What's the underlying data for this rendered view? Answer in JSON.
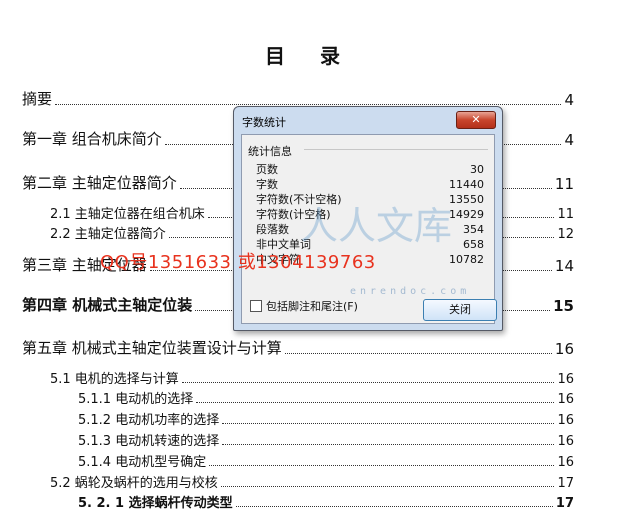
{
  "document": {
    "title": "目 录",
    "toc": [
      {
        "label": "摘要",
        "page": "4"
      },
      {
        "label": "第一章  组合机床简介",
        "page": "4"
      },
      {
        "label": "第二章  主轴定位器简介",
        "page": "11"
      },
      {
        "label": "2.1 主轴定位器在组合机床",
        "page": "11"
      },
      {
        "label": "2.2 主轴定位器简介",
        "page": "12"
      },
      {
        "label": "第三章  主轴定位器",
        "page": "14"
      },
      {
        "label": "第四章  机械式主轴定位装",
        "page": "15"
      },
      {
        "label": "第五章  机械式主轴定位装置设计与计算",
        "page": "16"
      },
      {
        "label": "5.1 电机的选择与计算",
        "page": "16"
      },
      {
        "label": "5.1.1 电动机的选择",
        "page": "16"
      },
      {
        "label": "5.1.2 电动机功率的选择",
        "page": "16"
      },
      {
        "label": "5.1.3 电动机转速的选择",
        "page": "16"
      },
      {
        "label": "5.1.4 电动机型号确定",
        "page": "16"
      },
      {
        "label": "5.2   蜗轮及蜗杆的选用与校核",
        "page": "17"
      },
      {
        "label": "5. 2. 1   选择蜗杆传动类型",
        "page": "17"
      }
    ]
  },
  "dialog": {
    "title": "字数统计",
    "close_glyph": "✕",
    "group_label": "统计信息",
    "stats": [
      {
        "label": "页数",
        "value": "30"
      },
      {
        "label": "字数",
        "value": "11440"
      },
      {
        "label": "字符数(不计空格)",
        "value": "13550"
      },
      {
        "label": "字符数(计空格)",
        "value": "14929"
      },
      {
        "label": "段落数",
        "value": "354"
      },
      {
        "label": "非中文单词",
        "value": "658"
      },
      {
        "label": "中文字符",
        "value": "10782"
      }
    ],
    "checkbox_label": "包括脚注和尾注(F)",
    "checkbox_checked": false,
    "close_button_label": "关闭"
  },
  "watermark": {
    "text": "QQ号1351633 或1304139763",
    "logo": "人人文库",
    "url": "enrendoc.com"
  }
}
